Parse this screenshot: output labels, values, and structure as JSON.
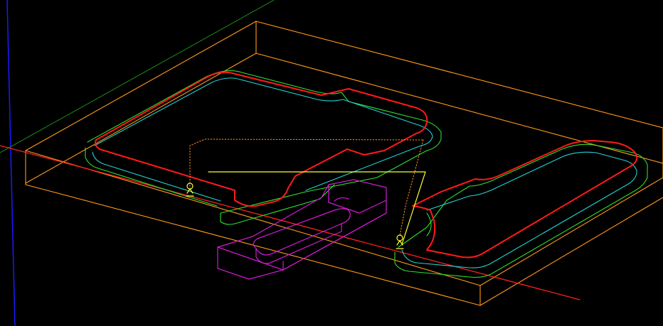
{
  "view": {
    "background_color": "#000000",
    "mode": "wireframe-3d"
  },
  "colors": {
    "x_axis": "#ff2020",
    "y_axis": "#1a8f1a",
    "z_axis": "#1a1aff",
    "stock_box": "#ff9a1a",
    "toolpath_primary": "#ff1a1a",
    "toolpath_offset_1": "#22d3d3",
    "toolpath_offset_2": "#2ee02e",
    "rapid_moves": "#ff9a1a",
    "tool_indicator": "#ffff33",
    "fixture": "#d21ad2"
  },
  "icons": {
    "entry_marker": "tool-entry-icon",
    "stock": "stock-box-icon",
    "fixture": "clamp-fixture-icon"
  }
}
